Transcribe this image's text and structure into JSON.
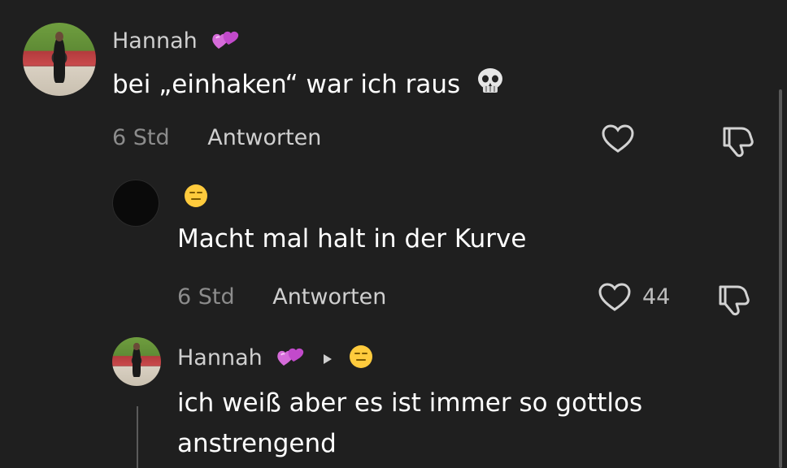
{
  "comments": [
    {
      "username": "Hannah",
      "text": "bei „einhaken“ war ich raus",
      "time": "6 Std",
      "reply_label": "Antworten",
      "like_count": ""
    },
    {
      "username": "",
      "text": "Macht mal halt in der Kurve",
      "time": "6 Std",
      "reply_label": "Antworten",
      "like_count": "44"
    },
    {
      "username": "Hannah",
      "text": "ich weiß aber es ist immer so gottlos anstrengend"
    }
  ],
  "icons": {
    "heart": "heart-icon",
    "dislike": "thumbs-down-icon",
    "reply_arrow": "reply-arrow-icon",
    "hearts_emoji": "two-hearts-emoji",
    "skull_emoji": "skull-emoji",
    "face_emoji": "expressionless-face-emoji"
  },
  "colors": {
    "background": "#1f1f1f",
    "text": "#ffffff",
    "muted": "#8c8c8c",
    "secondary": "#cfcfcf"
  }
}
